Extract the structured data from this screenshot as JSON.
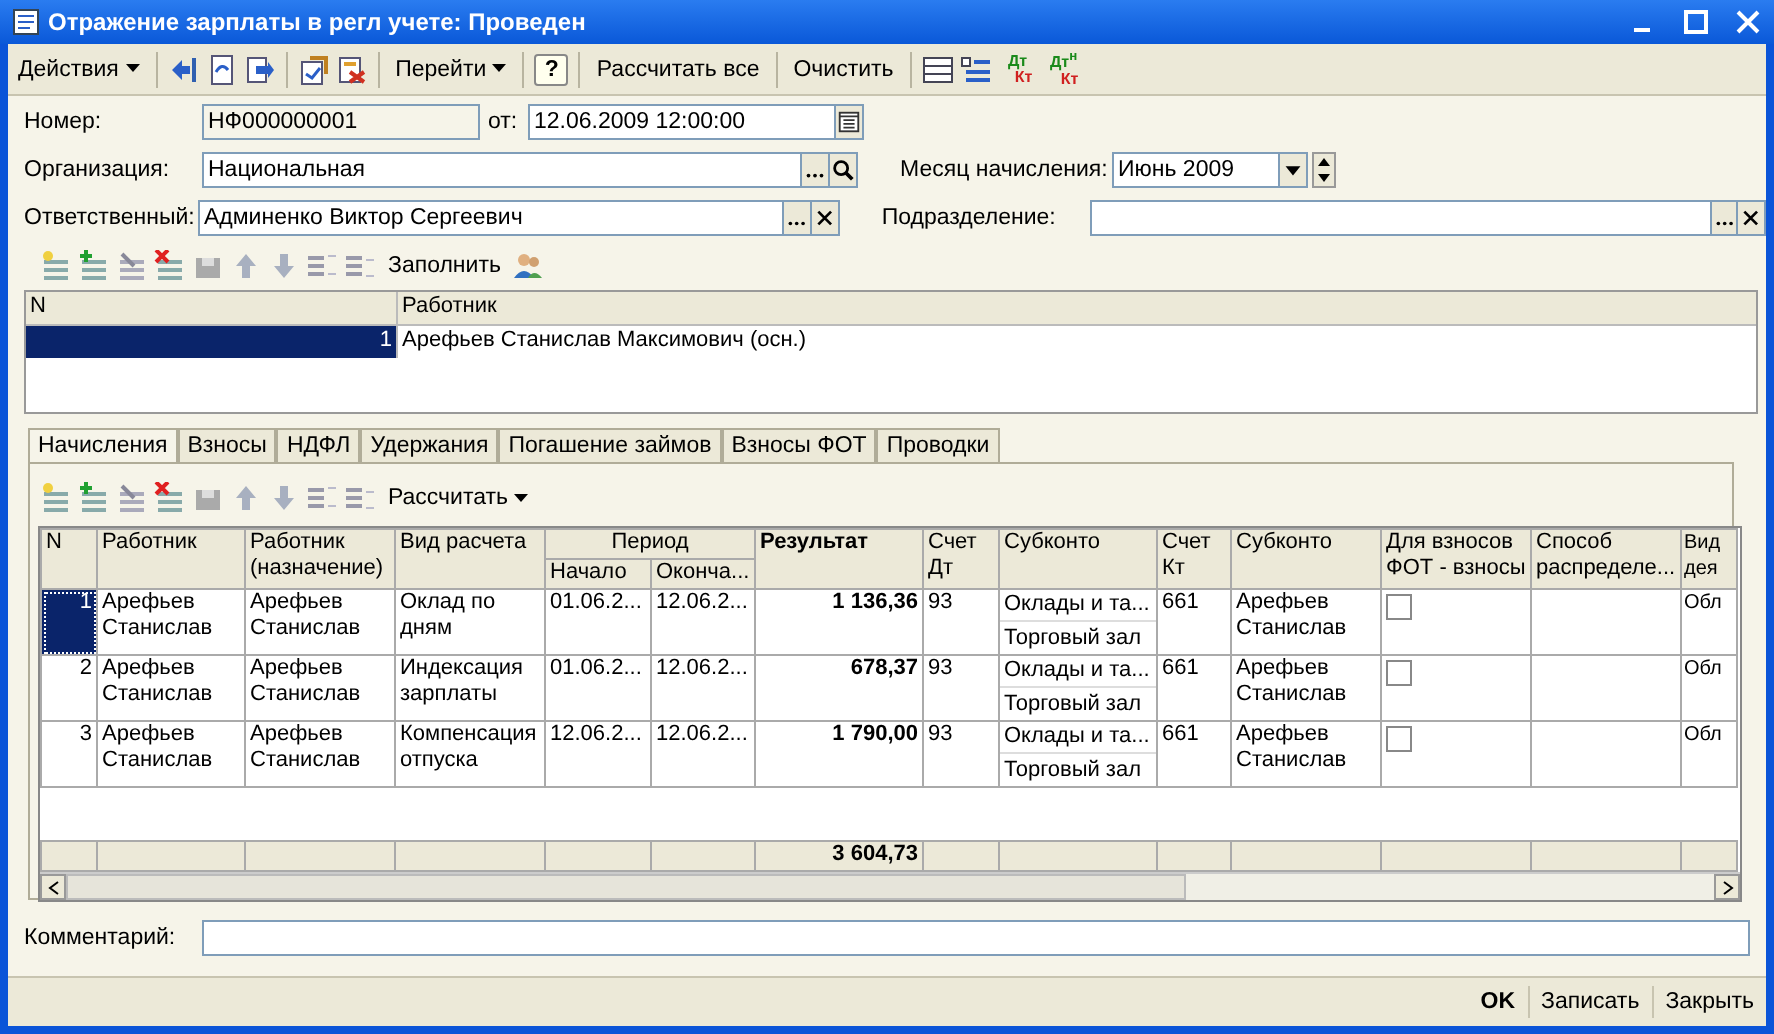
{
  "window": {
    "title": "Отражение зарплаты в регл учете: Проведен"
  },
  "toolbar": {
    "actions_menu": "Действия",
    "goto_menu": "Перейти",
    "help": "?",
    "calculate_all": "Рассчитать все",
    "clear": "Очистить",
    "entries": [
      {
        "top": "Дт",
        "bottom": "Кт"
      },
      {
        "top": "Дт$^{н}$",
        "bottom": "Кт"
      }
    ]
  },
  "form": {
    "number": {
      "label": "Номер:",
      "value": "НФ000000001"
    },
    "date": {
      "label": "от:",
      "value": "12.06.2009 12:00:00"
    },
    "organization": {
      "label": "Организация:",
      "value": "Национальная"
    },
    "month": {
      "label": "Месяц начисления:",
      "value": "Июнь 2009"
    },
    "responsible": {
      "label": "Ответственный:",
      "value": "Админенко Виктор Сергеевич"
    },
    "department": {
      "label": "Подразделение:"
    }
  },
  "workers": {
    "fill_button": "Заполнить",
    "columns": [
      "N",
      "Работник"
    ],
    "rows": [
      {
        "n": "1",
        "name": "Арефьев Станислав Максимович (осн.)",
        "selected": true
      }
    ]
  },
  "tabs": [
    {
      "label": "Начисления",
      "selected": true
    },
    {
      "label": "Взносы",
      "selected": false
    },
    {
      "label": "НДФЛ",
      "selected": false
    },
    {
      "label": "Удержания",
      "selected": false
    },
    {
      "label": "Погашение займов",
      "selected": false
    },
    {
      "label": "Взносы ФОТ",
      "selected": false
    },
    {
      "label": "Проводки",
      "selected": false
    }
  ],
  "grid": {
    "calculate_menu": "Рассчитать",
    "header": {
      "n": "N",
      "worker": "Работник",
      "assignment": "Работник (назначение)",
      "calc_type": "Вид расчета",
      "period": "Период",
      "start": "Начало",
      "end": "Оконча...",
      "result": "Результат",
      "debit": "Счет Дт",
      "subconto_dt": "Субконто",
      "credit": "Счет Кт",
      "subconto_kt": "Субконто",
      "fot": "Для взносов ФОТ - взносы",
      "method": "Способ распределе...",
      "activity": "Вид дея"
    },
    "rows": [
      {
        "n": "1",
        "worker": "Арефьев Станислав",
        "assignment": "Арефьев Станислав",
        "calc_type": "Оклад по дням",
        "start": "01.06.2...",
        "end": "12.06.2...",
        "result": "1 136,36",
        "debit": "93",
        "subconto_dt": [
          "Оклады и та...",
          "Торговый зал"
        ],
        "credit": "661",
        "subconto_kt": "Арефьев Станислав",
        "fot": false,
        "activity": "Обл",
        "selected": true
      },
      {
        "n": "2",
        "worker": "Арефьев Станислав",
        "assignment": "Арефьев Станислав",
        "calc_type": "Индексация зарплаты",
        "start": "01.06.2...",
        "end": "12.06.2...",
        "result": "678,37",
        "debit": "93",
        "subconto_dt": [
          "Оклады и та...",
          "Торговый зал"
        ],
        "credit": "661",
        "subconto_kt": "Арефьев Станислав",
        "fot": false,
        "activity": "Обл",
        "selected": false
      },
      {
        "n": "3",
        "worker": "Арефьев Станислав",
        "assignment": "Арефьев Станислав",
        "calc_type": "Компенсация отпуска",
        "start": "12.06.2...",
        "end": "12.06.2...",
        "result": "1 790,00",
        "debit": "93",
        "subconto_dt": [
          "Оклады и та...",
          "Торговый зал"
        ],
        "credit": "661",
        "subconto_kt": "Арефьев Станислав",
        "fot": false,
        "activity": "Обл",
        "selected": false
      }
    ],
    "total_result": "3 604,73"
  },
  "comment": {
    "label": "Комментарий:"
  },
  "footer": {
    "ok": "OK",
    "save": "Записать",
    "close": "Закрыть"
  }
}
